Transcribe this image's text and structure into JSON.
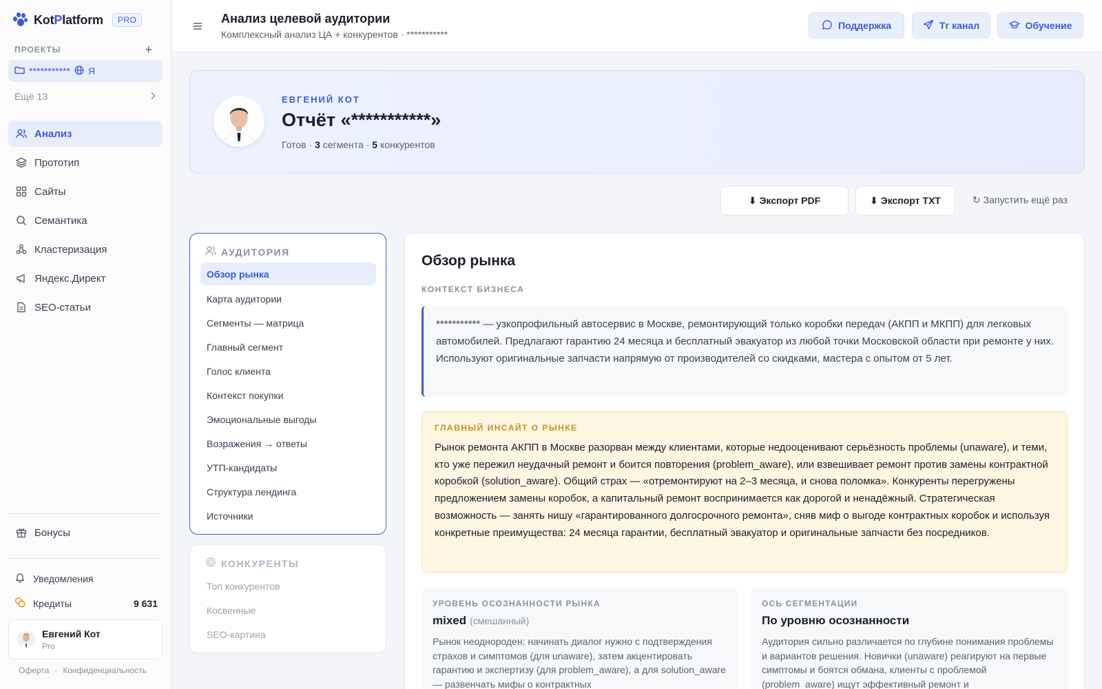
{
  "brand": {
    "name_part1": "Kot",
    "name_accent": "P",
    "name_part2": "latform",
    "badge": "PRO"
  },
  "sidebar": {
    "projects_label": "ПРОЕКТЫ",
    "add_symbol": "+",
    "active_project": {
      "name": "***********",
      "suffix": "Я"
    },
    "more_label": "Ещё 13",
    "nav": [
      {
        "label": "Анализ",
        "icon": "users-icon"
      },
      {
        "label": "Прототип",
        "icon": "layers-icon"
      },
      {
        "label": "Сайты",
        "icon": "grid-icon"
      },
      {
        "label": "Семантика",
        "icon": "search-icon"
      },
      {
        "label": "Кластеризация",
        "icon": "cluster-icon"
      },
      {
        "label": "Яндекс.Директ",
        "icon": "megaphone-icon"
      },
      {
        "label": "SEO-статьи",
        "icon": "document-icon"
      }
    ],
    "bonus_label": "Бонусы",
    "notifications_label": "Уведомления",
    "credits_label": "Кредиты",
    "credits_value": "9 631",
    "user": {
      "name": "Евгений Кот",
      "plan": "Pro"
    },
    "legal": {
      "offer": "Оферта",
      "dot": "·",
      "privacy": "Конфиденциальность"
    }
  },
  "topbar": {
    "title": "Анализ целевой аудитории",
    "subtitle": "Комплексный анализ ЦА + конкурентов · ***********",
    "support_label": "Поддержка",
    "tg_label": "Тг канал",
    "learning_label": "Обучение"
  },
  "hero": {
    "author": "ЕВГЕНИЙ КОТ",
    "title": "Отчёт «***********»",
    "status": "Готов",
    "sep": "·",
    "segments_count": "3",
    "segments_word": "сегмента",
    "competitors_count": "5",
    "competitors_word": "конкурентов"
  },
  "actions": {
    "export_pdf": "⬇ Экспорт PDF",
    "export_txt": "⬇ Экспорт TXT",
    "rerun": "↻ Запустить ещё раз"
  },
  "toc": {
    "audience_heading": "АУДИТОРИЯ",
    "audience_items": [
      "Обзор рынка",
      "Карта аудитории",
      "Сегменты — матрица",
      "Главный сегмент",
      "Голос клиента",
      "Контекст покупки",
      "Эмоциональные выгоды",
      "Возражения → ответы",
      "УТП-кандидаты",
      "Структура лендинга",
      "Источники"
    ],
    "competitors_heading": "КОНКУРЕНТЫ",
    "competitors_items": [
      "Топ конкурентов",
      "Косвенные",
      "SEO-картина"
    ]
  },
  "content": {
    "title": "Обзор рынка",
    "context_label": "КОНТЕКСТ БИЗНЕСА",
    "context_text": "*********** — узкопрофильный автосервис в Москве, ремонтирующий только коробки передач (АКПП и МКПП) для легковых автомобилей. Предлагают гарантию 24 месяца и бесплатный эвакуатор из любой точки Московской области при ремонте у них. Используют оригинальные запчасти напрямую от производителей со скидками, мастера с опытом от 5 лет.",
    "insight_label": "ГЛАВНЫЙ ИНСАЙТ О РЫНКЕ",
    "insight_text": "Рынок ремонта АКПП в Москве разорван между клиентами, которые недооценивают серьёзность проблемы (unaware), и теми, кто уже пережил неудачный ремонт и боится повторения (problem_aware), или взвешивает ремонт против замены контрактной коробкой (solution_aware). Общий страх — «отремонтируют на 2–3 месяца, и снова поломка». Конкуренты перегружены предложением замены коробок, а капитальный ремонт воспринимается как дорогой и ненадёжный. Стратегическая возможность — занять нишу «гарантированного долгосрочного ремонта», сняв миф о выгоде контрактных коробок и используя конкретные преимущества: 24 месяца гарантии, бесплатный эвакуатор и оригинальные запчасти без посредников.",
    "awareness": {
      "label": "УРОВЕНЬ ОСОЗНАННОСТИ РЫНКА",
      "value": "mixed",
      "value_note": "(смешанный)",
      "text": "Рынок неоднороден: начинать диалог нужно с подтверждения страхов и симптомов (для unaware), затем акцентировать гарантию и экспертизу (для problem_aware), а для solution_aware — развенчать мифы о контрактных"
    },
    "segmentation": {
      "label": "ОСЬ СЕГМЕНТАЦИИ",
      "value": "По уровню осознанности",
      "text": "Аудитория сильно различается по глубине понимания проблемы и вариантов решения. Новички (unaware) реагируют на первые симптомы и боятся обмана, клиенты с проблемой (problem_aware) ищут эффективный ремонт и"
    }
  }
}
